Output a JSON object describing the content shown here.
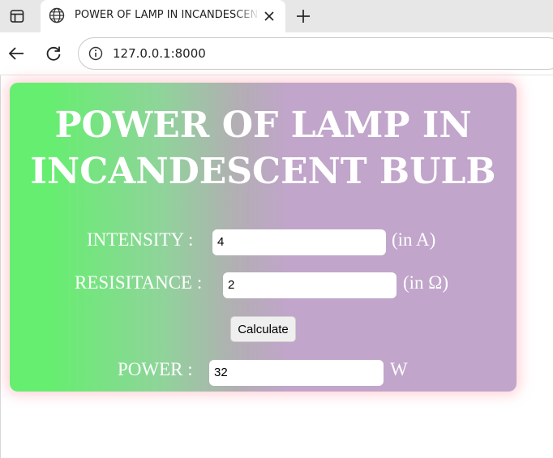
{
  "browser": {
    "tab_title": "POWER OF LAMP IN INCANDESCENT BULB",
    "url": "127.0.0.1:8000",
    "icons": {
      "sidebar": "sidebar-icon",
      "favicon": "globe-icon",
      "close": "close-icon",
      "new_tab": "plus-icon",
      "back": "back-arrow-icon",
      "reload": "reload-icon",
      "site_info": "info-icon"
    }
  },
  "page": {
    "title_line1": "POWER OF LAMP IN",
    "title_line2": "INCANDESCENT BULB",
    "intensity": {
      "label": "INTENSITY :",
      "value": "4",
      "unit": "(in A)"
    },
    "resistance": {
      "label": "RESISITANCE :",
      "value": "2",
      "unit": "(in Ω)"
    },
    "calculate_label": "Calculate",
    "power": {
      "label": "POWER :",
      "value": "32",
      "unit": "W"
    },
    "colors": {
      "gradient_start": "#66ee70",
      "gradient_end": "#c1a5cb",
      "text": "#ffffff"
    }
  }
}
